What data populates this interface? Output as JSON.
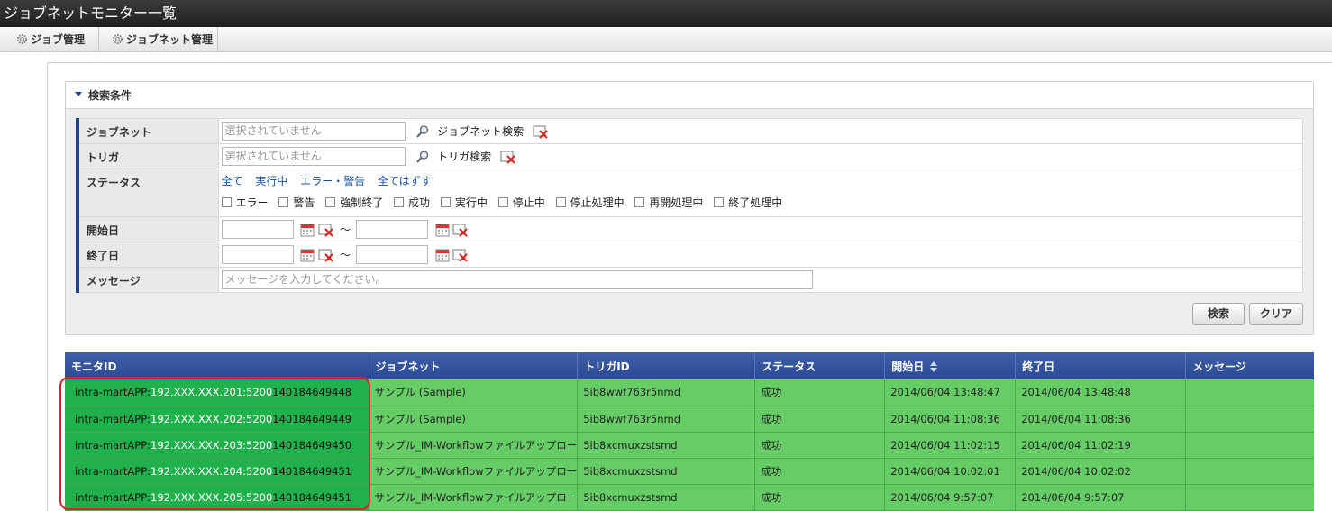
{
  "window": {
    "title": "ジョブネットモニター一覧"
  },
  "menu": [
    {
      "label": "ジョブ管理",
      "icon": "gear-icon"
    },
    {
      "label": "ジョブネット管理",
      "icon": "gear-icon"
    }
  ],
  "search": {
    "header": "検索条件",
    "jobnet": {
      "label": "ジョブネット",
      "placeholder": "選択されていません",
      "search_label": "ジョブネット検索"
    },
    "trigger": {
      "label": "トリガ",
      "placeholder": "選択されていません",
      "search_label": "トリガ検索"
    },
    "status": {
      "label": "ステータス",
      "links": [
        "全て",
        "実行中",
        "エラー・警告",
        "全てはずす"
      ],
      "options": [
        "エラー",
        "警告",
        "強制終了",
        "成功",
        "実行中",
        "停止中",
        "停止処理中",
        "再開処理中",
        "終了処理中"
      ]
    },
    "start_date": {
      "label": "開始日",
      "separator": "〜"
    },
    "end_date": {
      "label": "終了日",
      "separator": "〜"
    },
    "message": {
      "label": "メッセージ",
      "placeholder": "メッセージを入力してください。"
    },
    "buttons": {
      "search": "検索",
      "clear": "クリア"
    }
  },
  "results": {
    "columns": [
      "モニタID",
      "ジョブネット",
      "トリガID",
      "ステータス",
      "開始日",
      "終了日",
      "メッセージ"
    ],
    "rows": [
      {
        "monitor_prefix": "intra-martAPP:",
        "monitor_ip": "192.XXX.XXX.201:5200",
        "monitor_suffix": "140184649448",
        "jobnet": "サンプル (Sample)",
        "trigger": "5ib8wwf763r5nmd",
        "status": "成功",
        "start": "2014/06/04 13:48:47",
        "end": "2014/06/04 13:48:48",
        "message": ""
      },
      {
        "monitor_prefix": "intra-martAPP:",
        "monitor_ip": "192.XXX.XXX.202:5200",
        "monitor_suffix": "140184649449",
        "jobnet": "サンプル (Sample)",
        "trigger": "5ib8wwf763r5nmd",
        "status": "成功",
        "start": "2014/06/04 11:08:36",
        "end": "2014/06/04 11:08:36",
        "message": ""
      },
      {
        "monitor_prefix": "intra-martAPP:",
        "monitor_ip": "192.XXX.XXX.203:5200",
        "monitor_suffix": "140184649450",
        "jobnet": "サンプル_IM-Workflowファイルアップロー",
        "trigger": "5ib8xcmuxzstsmd",
        "status": "成功",
        "start": "2014/06/04 11:02:15",
        "end": "2014/06/04 11:02:19",
        "message": ""
      },
      {
        "monitor_prefix": "intra-martAPP:",
        "monitor_ip": "192.XXX.XXX.204:5200",
        "monitor_suffix": "140184649451",
        "jobnet": "サンプル_IM-Workflowファイルアップロー",
        "trigger": "5ib8xcmuxzstsmd",
        "status": "成功",
        "start": "2014/06/04 10:02:01",
        "end": "2014/06/04 10:02:02",
        "message": ""
      },
      {
        "monitor_prefix": "intra-martAPP:",
        "monitor_ip": "192.XXX.XXX.205:5200",
        "monitor_suffix": "140184649451",
        "jobnet": "サンプル_IM-Workflowファイルアップロー",
        "trigger": "5ib8xcmuxzstsmd",
        "status": "成功",
        "start": "2014/06/04 9:57:07",
        "end": "2014/06/04 9:57:07",
        "message": ""
      }
    ]
  },
  "colors": {
    "row_green": "#66cc66",
    "id_green": "#22b04c",
    "header_blue": "#2a4a94",
    "highlight_red": "#e31e2e"
  }
}
